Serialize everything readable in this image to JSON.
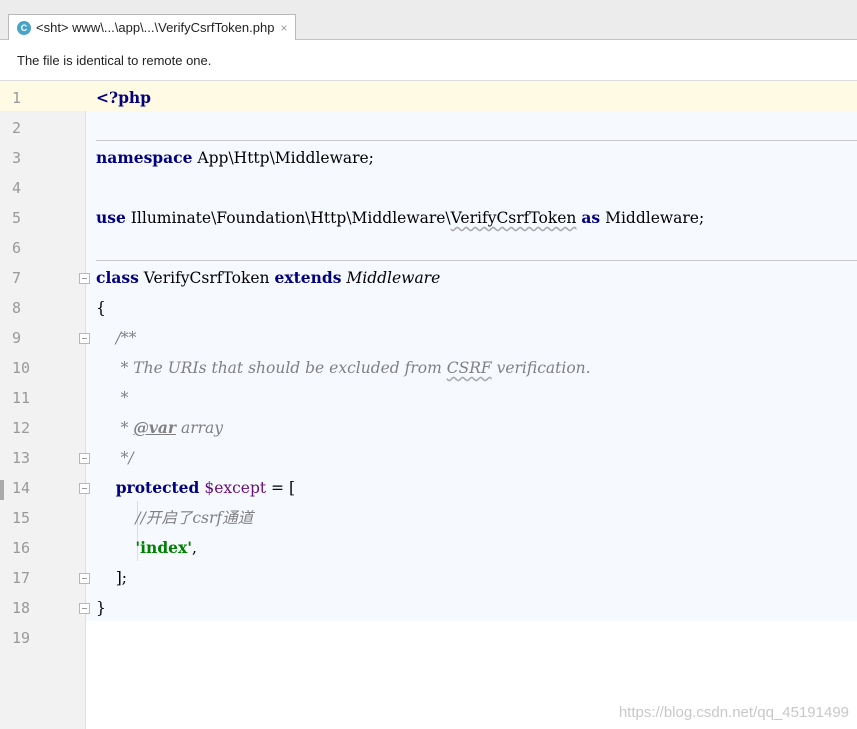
{
  "tab": {
    "icon": "php-class-icon",
    "icon_glyph": "C",
    "label": "<sht> www\\...\\app\\...\\VerifyCsrfToken.php",
    "close": "×"
  },
  "notice": "The file is identical to remote one.",
  "editor": {
    "line_numbers": [
      "1",
      "2",
      "3",
      "4",
      "5",
      "6",
      "7",
      "8",
      "9",
      "10",
      "11",
      "12",
      "13",
      "14",
      "15",
      "16",
      "17",
      "18",
      "19"
    ],
    "lines": [
      {
        "tokens": [
          {
            "t": "<?php",
            "c": "kw"
          }
        ]
      },
      {
        "tokens": []
      },
      {
        "tokens": [
          {
            "t": "namespace",
            "c": "kw"
          },
          {
            "t": " App\\Http\\Middleware;"
          }
        ]
      },
      {
        "tokens": []
      },
      {
        "tokens": [
          {
            "t": "use",
            "c": "kw"
          },
          {
            "t": " Illuminate\\Foundation\\Http\\Middleware\\"
          },
          {
            "t": "VerifyCsrfToken",
            "c": "wavy"
          },
          {
            "t": " "
          },
          {
            "t": "as",
            "c": "kw"
          },
          {
            "t": " Middleware;"
          }
        ]
      },
      {
        "tokens": []
      },
      {
        "tokens": [
          {
            "t": "class",
            "c": "kw"
          },
          {
            "t": " VerifyCsrfToken "
          },
          {
            "t": "extends",
            "c": "kw"
          },
          {
            "t": " "
          },
          {
            "t": "Middleware",
            "c": "ital"
          }
        ]
      },
      {
        "tokens": [
          {
            "t": "{"
          }
        ]
      },
      {
        "tokens": [
          {
            "t": "    /**",
            "c": "cmt"
          }
        ]
      },
      {
        "tokens": [
          {
            "t": "     * The URIs that should be excluded from ",
            "c": "cmt"
          },
          {
            "t": "CSRF",
            "c": "cmt wavy"
          },
          {
            "t": " verification.",
            "c": "cmt"
          }
        ]
      },
      {
        "tokens": [
          {
            "t": "     *",
            "c": "cmt"
          }
        ]
      },
      {
        "tokens": [
          {
            "t": "     * ",
            "c": "cmt"
          },
          {
            "t": "@var",
            "c": "tag"
          },
          {
            "t": " array",
            "c": "cmt"
          }
        ]
      },
      {
        "tokens": [
          {
            "t": "     */",
            "c": "cmt"
          }
        ]
      },
      {
        "tokens": [
          {
            "t": "    "
          },
          {
            "t": "protected",
            "c": "kw"
          },
          {
            "t": " "
          },
          {
            "t": "$except",
            "c": "var"
          },
          {
            "t": " = ["
          }
        ]
      },
      {
        "tokens": [
          {
            "t": "        //开启了csrf通道",
            "c": "cmt"
          }
        ]
      },
      {
        "tokens": [
          {
            "t": "        "
          },
          {
            "t": "'index'",
            "c": "str"
          },
          {
            "t": ","
          }
        ]
      },
      {
        "tokens": [
          {
            "t": "    ];"
          }
        ]
      },
      {
        "tokens": [
          {
            "t": "}"
          }
        ]
      },
      {
        "tokens": []
      }
    ]
  },
  "watermark": "https://blog.csdn.net/qq_45191499"
}
